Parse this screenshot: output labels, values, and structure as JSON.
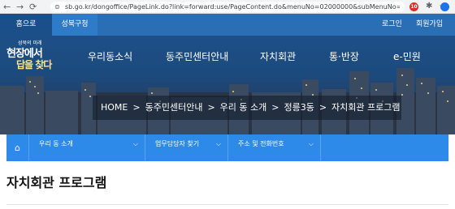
{
  "browser": {
    "url": "sb.go.kr/dongoffice/PageLink.do?link=forward:use/PageContent.do&menuNo=02000000&subMenuNo=02220000&thirdMenu...",
    "badge": "10"
  },
  "topbar": {
    "home": "홈으로",
    "seongbuk": "성북구청",
    "login": "로그인",
    "join": "회원가입"
  },
  "logo": {
    "small": "성북의 미래",
    "line1": "현장에서",
    "line2": "답을 찾다"
  },
  "gnb": [
    "우리동소식",
    "동주민센터안내",
    "자치회관",
    "통·반장",
    "e-민원"
  ],
  "breadcrumb": [
    "HOME",
    "동주민센터안내",
    "우리 동 소개",
    "정릉3동",
    "자치회관 프로그램"
  ],
  "breadcrumb_sep": ">",
  "subnav": {
    "items": [
      "우리 동 소개",
      "업무담당자 찾기",
      "주소 및 전화번호"
    ]
  },
  "page_title": "자치회관 프로그램",
  "colors": {
    "topbar": "#2a6fb6",
    "subnav": "#2d8ae8",
    "hero": "#1d4f86"
  }
}
